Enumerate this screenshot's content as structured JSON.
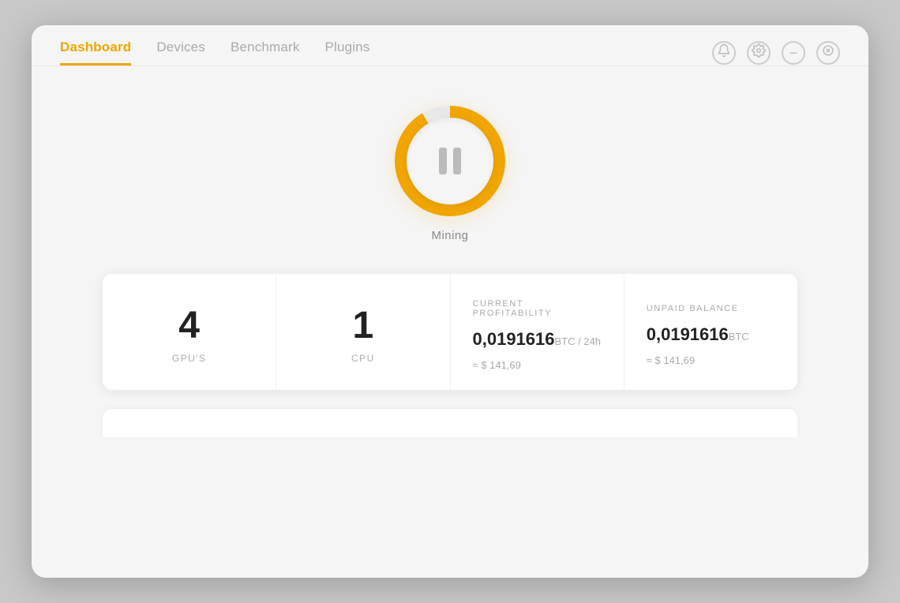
{
  "nav": {
    "tabs": [
      {
        "id": "dashboard",
        "label": "Dashboard",
        "active": true
      },
      {
        "id": "devices",
        "label": "Devices",
        "active": false
      },
      {
        "id": "benchmark",
        "label": "Benchmark",
        "active": false
      },
      {
        "id": "plugins",
        "label": "Plugins",
        "active": false
      }
    ]
  },
  "window_controls": {
    "notification_icon": "🔔",
    "settings_icon": "⚙",
    "minimize_icon": "−",
    "close_icon": "✕"
  },
  "mining": {
    "button_label": "Mining",
    "state": "paused"
  },
  "stats": {
    "gpus": {
      "value": "4",
      "label": "GPU'S"
    },
    "cpu": {
      "value": "1",
      "label": "CPU"
    },
    "profitability": {
      "title": "CURRENT PROFITABILITY",
      "main_value": "0,0191616",
      "unit": " BTC / 24h",
      "sub_value": "≈ $ 141,69"
    },
    "balance": {
      "title": "UNPAID BALANCE",
      "main_value": "0,0191616",
      "unit": " BTC",
      "sub_value": "≈ $ 141,69"
    }
  }
}
